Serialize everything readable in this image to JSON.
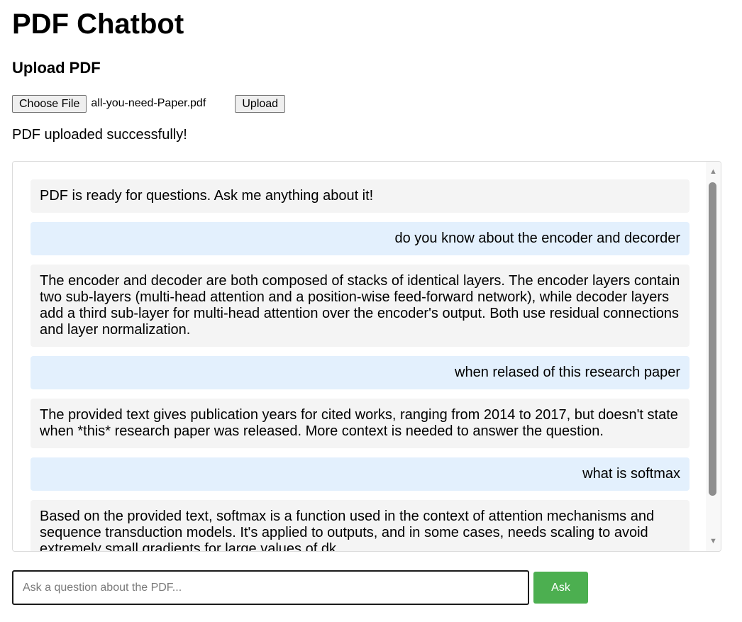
{
  "header": {
    "title": "PDF Chatbot"
  },
  "upload": {
    "heading": "Upload PDF",
    "choose_label": "Choose File",
    "file_name": "all-you-need-Paper.pdf",
    "upload_label": "Upload",
    "status": "PDF uploaded successfully!"
  },
  "chat": {
    "messages": [
      {
        "role": "bot",
        "text": "PDF is ready for questions. Ask me anything about it!"
      },
      {
        "role": "user",
        "text": "do you know about the encoder and decorder"
      },
      {
        "role": "bot",
        "text": "The encoder and decoder are both composed of stacks of identical layers. The encoder layers contain two sub-layers (multi-head attention and a position-wise feed-forward network), while decoder layers add a third sub-layer for multi-head attention over the encoder's output. Both use residual connections and layer normalization."
      },
      {
        "role": "user",
        "text": "when relased of this research paper"
      },
      {
        "role": "bot",
        "text": "The provided text gives publication years for cited works, ranging from 2014 to 2017, but doesn't state when *this* research paper was released. More context is needed to answer the question."
      },
      {
        "role": "user",
        "text": "what is softmax"
      },
      {
        "role": "bot",
        "text": "Based on the provided text, softmax is a function used in the context of attention mechanisms and sequence transduction models. It's applied to outputs, and in some cases, needs scaling to avoid extremely small gradients for large values of dk."
      }
    ],
    "colors": {
      "bot_bubble": "#f4f4f4",
      "user_bubble": "#e3f0fd"
    }
  },
  "ask": {
    "placeholder": "Ask a question about the PDF...",
    "value": "",
    "button_label": "Ask",
    "button_color": "#4caf50"
  }
}
